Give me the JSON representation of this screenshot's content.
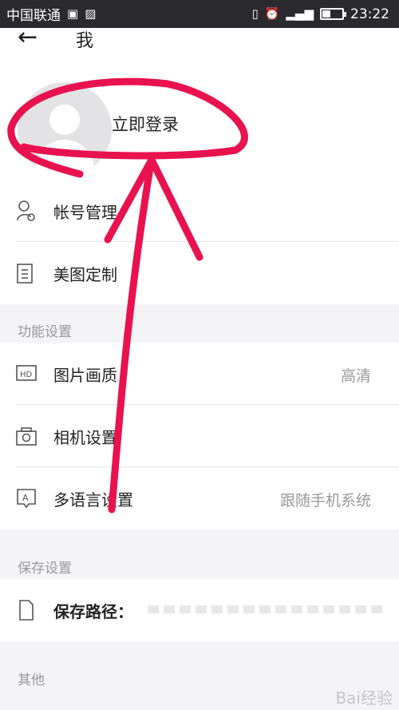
{
  "status_bar": {
    "carrier": "中国联通",
    "time": "23:22"
  },
  "header": {
    "title": "我"
  },
  "profile": {
    "login_label": "立即登录"
  },
  "account_items": [
    {
      "label": "帐号管理",
      "icon": "user-settings-icon"
    },
    {
      "label": "美图定制",
      "icon": "document-icon"
    }
  ],
  "sections": {
    "function_settings": "功能设置",
    "save_settings": "保存设置",
    "other": "其他"
  },
  "function_items": [
    {
      "label": "图片画质",
      "value": "高清",
      "icon": "hd-icon"
    },
    {
      "label": "相机设置",
      "value": "",
      "icon": "camera-icon"
    },
    {
      "label": "多语言设置",
      "value": "跟随手机系统",
      "icon": "language-icon"
    }
  ],
  "save_items": [
    {
      "label": "保存路径：",
      "icon": "file-icon"
    }
  ],
  "watermark": "Bai经验",
  "colors": {
    "annotation": "#e8124f",
    "status_bar": "#2a2a2e",
    "background": "#f4f3f5"
  }
}
